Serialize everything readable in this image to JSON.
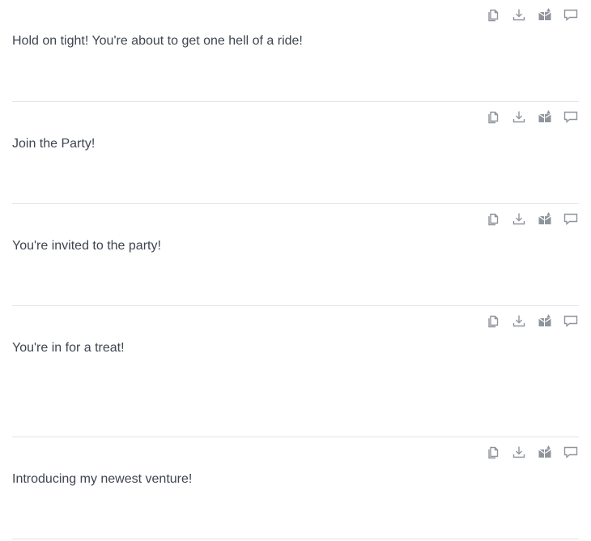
{
  "results": [
    {
      "text": "Hold on tight! You're about to get one hell of a ride!"
    },
    {
      "text": "Join the Party!"
    },
    {
      "text": "You're invited to the party!"
    },
    {
      "text": "You're in for a treat!"
    },
    {
      "text": "Introducing my newest venture!"
    }
  ],
  "icons": {
    "copy": "copy-icon",
    "download": "download-icon",
    "mail": "mail-icon",
    "comment": "comment-icon"
  },
  "colors": {
    "text": "#3f4550",
    "icon": "#8f949c",
    "divider": "#e2e4e8"
  }
}
